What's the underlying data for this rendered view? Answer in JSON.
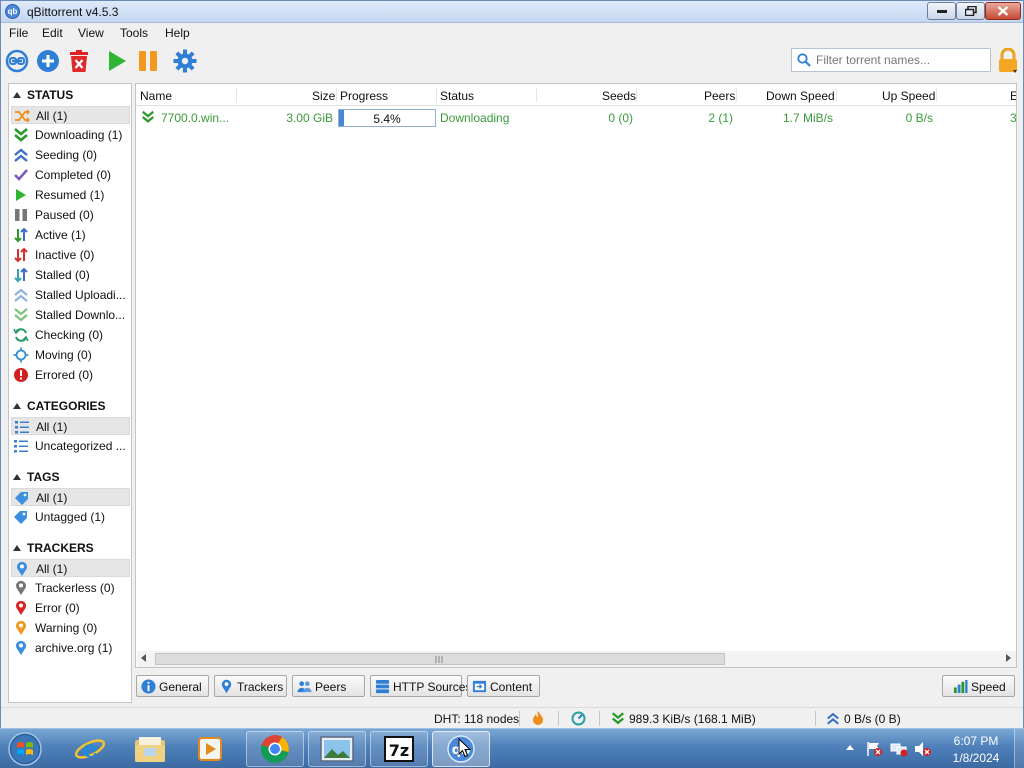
{
  "window": {
    "title": "qBittorrent v4.5.3",
    "app_icon_text": "qb"
  },
  "menu": [
    "File",
    "Edit",
    "View",
    "Tools",
    "Help"
  ],
  "toolbar": {
    "buttons": [
      "link-icon",
      "add-icon",
      "delete-icon",
      "resume-icon",
      "pause-icon",
      "options-gear-icon"
    ],
    "filter_placeholder": "Filter torrent names...",
    "filter_value": ""
  },
  "sidebar": {
    "status": {
      "header": "STATUS",
      "items": [
        {
          "label": "All (1)",
          "icon": "all-shuffle-icon",
          "selected": true
        },
        {
          "label": "Downloading (1)",
          "icon": "downloading-icon"
        },
        {
          "label": "Seeding (0)",
          "icon": "seeding-icon"
        },
        {
          "label": "Completed (0)",
          "icon": "completed-check-icon"
        },
        {
          "label": "Resumed (1)",
          "icon": "resumed-play-icon"
        },
        {
          "label": "Paused (0)",
          "icon": "paused-icon"
        },
        {
          "label": "Active (1)",
          "icon": "active-arrows-icon"
        },
        {
          "label": "Inactive (0)",
          "icon": "inactive-arrows-icon"
        },
        {
          "label": "Stalled (0)",
          "icon": "stalled-arrows-icon"
        },
        {
          "label": "Stalled Uploadi...",
          "icon": "stalled-upload-icon"
        },
        {
          "label": "Stalled Downlo...",
          "icon": "stalled-download-icon"
        },
        {
          "label": "Checking (0)",
          "icon": "checking-icon"
        },
        {
          "label": "Moving (0)",
          "icon": "moving-icon"
        },
        {
          "label": "Errored (0)",
          "icon": "errored-icon"
        }
      ]
    },
    "categories": {
      "header": "CATEGORIES",
      "items": [
        {
          "label": "All (1)",
          "icon": "list-icon",
          "selected": true
        },
        {
          "label": "Uncategorized ...",
          "icon": "list-icon"
        }
      ]
    },
    "tags": {
      "header": "TAGS",
      "items": [
        {
          "label": "All (1)",
          "icon": "tag-icon",
          "selected": true
        },
        {
          "label": "Untagged (1)",
          "icon": "tag-icon"
        }
      ]
    },
    "trackers": {
      "header": "TRACKERS",
      "items": [
        {
          "label": "All (1)",
          "icon": "pin-blue-icon",
          "selected": true
        },
        {
          "label": "Trackerless (0)",
          "icon": "pin-gray-icon"
        },
        {
          "label": "Error (0)",
          "icon": "pin-red-icon"
        },
        {
          "label": "Warning (0)",
          "icon": "pin-orange-icon"
        },
        {
          "label": "archive.org (1)",
          "icon": "pin-blue-icon"
        }
      ]
    }
  },
  "table": {
    "columns": [
      "Name",
      "Size",
      "Progress",
      "Status",
      "Seeds",
      "Peers",
      "Down Speed",
      "Up Speed",
      "E"
    ],
    "rows": [
      {
        "name": "7700.0.win...",
        "size": "3.00 GiB",
        "progress": 0.054,
        "progress_text": "5.4%",
        "status": "Downloading",
        "seeds": "0 (0)",
        "peers": "2 (1)",
        "down_speed": "1.7 MiB/s",
        "up_speed": "0 B/s",
        "eta": "3"
      }
    ]
  },
  "bottom_tabs": [
    "General",
    "Trackers",
    "Peers",
    "HTTP Sources",
    "Content"
  ],
  "speed_button": "Speed",
  "statusbar": {
    "dht": "DHT: 118 nodes",
    "download": "989.3 KiB/s (168.1 MiB)",
    "upload": "0 B/s (0 B)"
  },
  "taskbar": {
    "apps": [
      "internet-explorer-icon",
      "file-explorer-icon",
      "media-player-icon",
      "chrome-icon",
      "photo-viewer-icon",
      "7zip-icon",
      "qbittorrent-icon"
    ],
    "time": "6:07 PM",
    "date": "1/8/2024"
  },
  "colors": {
    "downloading_text": "#3a9a3a",
    "progress_fill": "#4a86d4",
    "accent_blue": "#2f7fd6"
  }
}
